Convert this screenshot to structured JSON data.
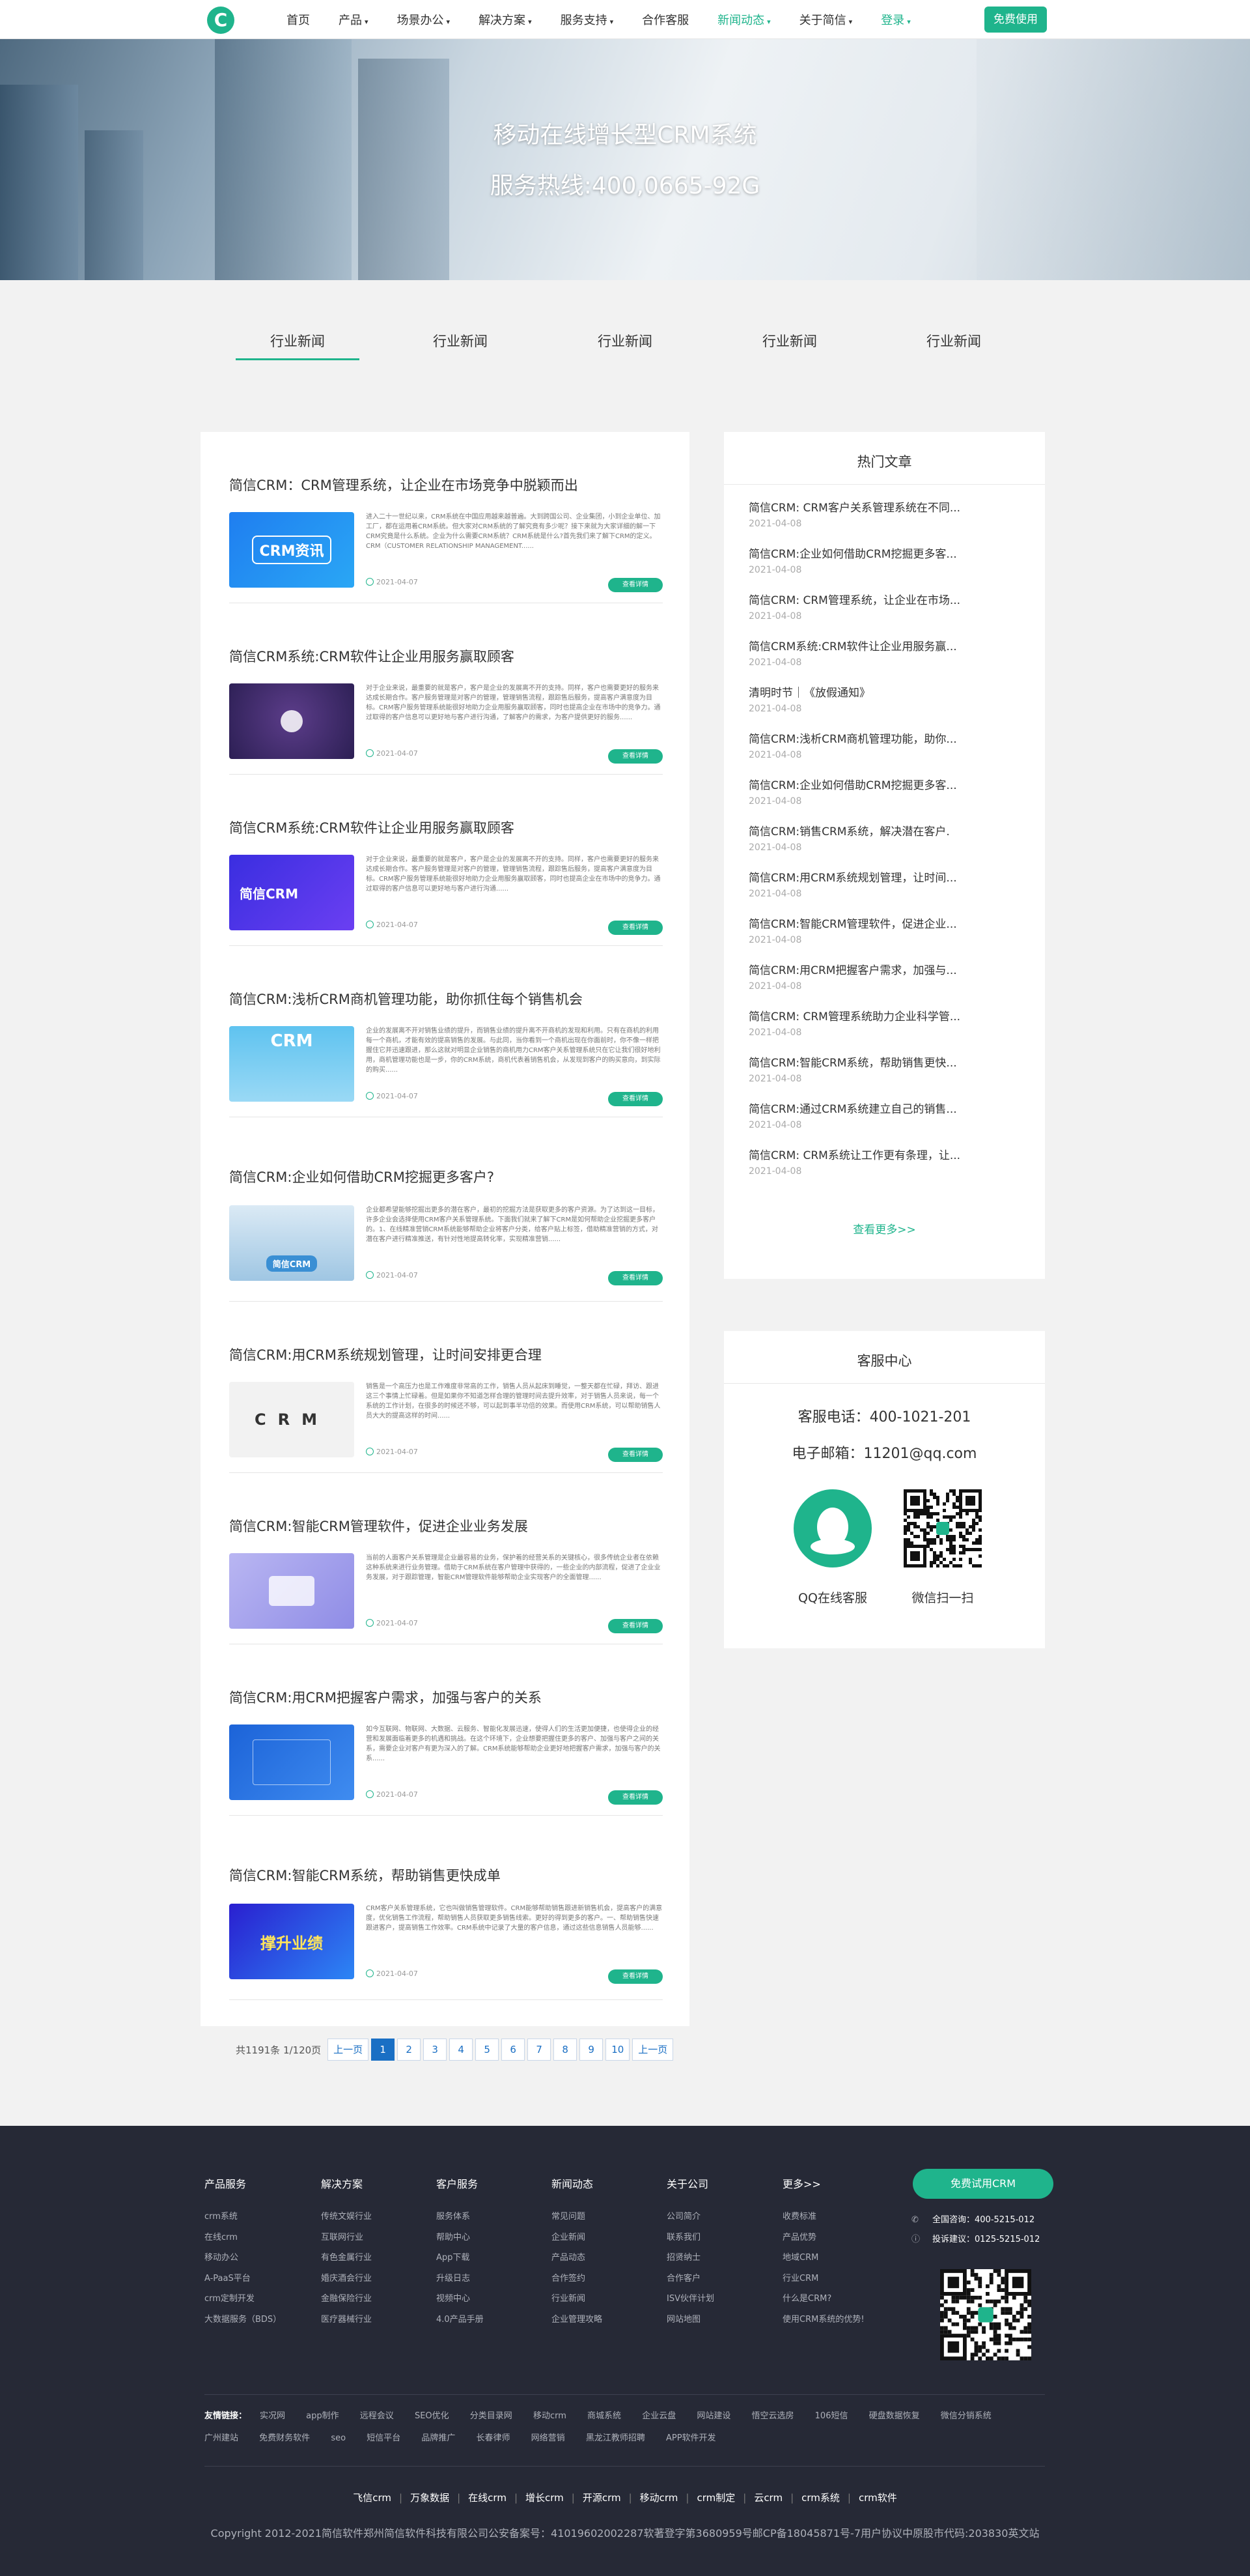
{
  "header": {
    "logo": "C",
    "nav": [
      {
        "label": "首页",
        "caret": ""
      },
      {
        "label": "产品",
        "caret": "▾"
      },
      {
        "label": "场景办公",
        "caret": "▾"
      },
      {
        "label": "解决方案",
        "caret": "▾"
      },
      {
        "label": "服务支持",
        "caret": "▾"
      },
      {
        "label": "合作客服",
        "caret": ""
      },
      {
        "label": "新闻动态",
        "caret": "▾"
      },
      {
        "label": "关于简信",
        "caret": "▾"
      },
      {
        "label": "登录",
        "caret": "▾"
      }
    ],
    "cta": "免费使用"
  },
  "banner": {
    "title": "移动在线增长型CRM系统",
    "hotline": "服务热线:400,0665-92G"
  },
  "tabs": [
    "行业新闻",
    "行业新闻",
    "行业新闻",
    "行业新闻",
    "行业新闻"
  ],
  "articles": [
    {
      "title": "简信CRM：CRM管理系统，让企业在市场竞争中脱颖而出",
      "thumb_text": "CRM资讯",
      "desc": "进入二十一世纪以来，CRM系统在中国应用越来越普遍。大到跨国公司、企业集团，小到企业单位、加工厂，都在运用着CRM系统。但大家对CRM系统的了解究竟有多少呢？接下来就为大家详细的解一下CRM究竟是什么系统。企业为什么需要CRM系统？CRM系统是什么?首先我们来了解下CRM的定义。CRM（CUSTOMER RELATIONSHIP MANAGEMENT......",
      "date": "2021-04-07",
      "more": "查看详情"
    },
    {
      "title": "简信CRM系统:CRM软件让企业用服务赢取顾客",
      "thumb_text": "",
      "desc": "对于企业来说，最重要的就是客户，客户是企业的发展离不开的支持。同样，客户也需要更好的服务来达成长期合作。客户服务管理是对客户的管理，管理销售流程，跟踪售后服务，提高客户满意度为目标。CRM客户服务管理系统能很好地助力企业用服务赢取顾客，同时也提高企业在市场中的竞争力。通过取得的客户信息可以更好地与客户进行沟通，了解客户的需求，为客户提供更好的服务......",
      "date": "2021-04-07",
      "more": "查看详情"
    },
    {
      "title": "简信CRM系统:CRM软件让企业用服务赢取顾客",
      "thumb_text": "简信CRM",
      "desc": "对于企业来说，最重要的就是客户，客户是企业的发展离不开的支持。同样，客户也需要更好的服务来达成长期合作。客户服务管理是对客户的管理，管理销售流程，跟踪售后服务，提高客户满意度为目标。CRM客户服务管理系统能很好地助力企业用服务赢取顾客，同时也提高企业在市场中的竞争力。通过取得的客户信息可以更好地与客户进行沟通......",
      "date": "2021-04-07",
      "more": "查看详情"
    },
    {
      "title": "简信CRM:浅析CRM商机管理功能，助你抓住每个销售机会",
      "thumb_text": "CRM",
      "desc": "企业的发展离不开对销售业绩的提升，而销售业绩的提升离不开商机的发现和利用。只有在商机的利用每一个商机，才能有效的提高销售的发展。与此同，当你看到一个商机出现在你面前时，你不像一样把握住它并迅速跟进，那么这就对明显企业销售的商机用力CRM客户关系管理系统只在它让我们很好地利用，商机管理功能也是一步，你的CRM系统，商机代表着销售机会，从发现到客户的购买意向，到实际的购买......",
      "date": "2021-04-07",
      "more": "查看详情"
    },
    {
      "title": "简信CRM:企业如何借助CRM挖掘更多客户?",
      "thumb_text": "简信CRM",
      "desc": "企业都希望能够挖掘出更多的潜在客户，最初的挖掘方法是获取更多的客户资源。为了达到这一目标，许多企业会选择使用CRM客户关系管理系统。下面我们就来了解下CRM是如何帮助企业挖掘更多客户的。1、在线精准营销CRM系统能够帮助企业将客户分类，给客户贴上标签，借助精准营销的方式，对潜在客户进行精准推送，有针对性地提高转化率，实现精准营销......",
      "date": "2021-04-07",
      "more": "查看详情"
    },
    {
      "title": "简信CRM:用CRM系统规划管理，让时间安排更合理",
      "thumb_text": "CRM",
      "desc": "销售是一个高压力也是工作难度非常高的工作，销售人员从起床到睡觉，一整天都在忙碌，拜访、跟进这三个事情上忙碌着。但是如果你不知道怎样合理的管理时间去提升效率，对于销售人员来说，每一个系统的工作计划，在很多的时候还不够，可以起到事半功倍的效果。而使用CRM系统，可以帮助销售人员大大的提高这样的时间......",
      "date": "2021-04-07",
      "more": "查看详情"
    },
    {
      "title": "简信CRM:智能CRM管理软件，促进企业业务发展",
      "thumb_text": "",
      "desc": "当前的人面客户关系管理是企业最容易的业务，保护着的经营关系的关键核心，很多传统企业者在依赖这种系统来进行业务管理。借助于CRM系统在客户管理中获得的，一些企业的内部流程，促进了企业业务发展，对于跟踪管理，智能CRM管理软件能够帮助企业实现客户的全面管理......",
      "date": "2021-04-07",
      "more": "查看详情"
    },
    {
      "title": "简信CRM:用CRM把握客户需求，加强与客户的关系",
      "thumb_text": "",
      "desc": "如今互联网、物联网、大数据、云服务、智能化发展迅速，使得人们的生活更加便捷，也使得企业的经营和发展面临着更多的机遇和挑战。在这个环境下，企业想要把握住更多的客户、加强与客户之间的关系，需要企业对客户有更为深入的了解。CRM系统能够帮助企业更好地把握客户需求，加强与客户的关系......",
      "date": "2021-04-07",
      "more": "查看详情"
    },
    {
      "title": "简信CRM:智能CRM系统，帮助销售更快成单",
      "thumb_text": "撑升业绩",
      "desc": "CRM客户关系管理系统，它也叫做销售管理软件。CRM能够帮助销售跟进新销售机会，提高客户的满意度，优化销售工作流程，帮助销售人员获取更多销售线索。更好的得到更多的客户。一、帮助销售快速跟进客户，提高销售工作效率。CRM系统中记录了大量的客户信息，通过这些信息销售人员能够......",
      "date": "2021-04-07",
      "more": "查看详情"
    }
  ],
  "pager": {
    "total": "共1191条 1/120页",
    "prev": "上一页",
    "pages": [
      "1",
      "2",
      "3",
      "4",
      "5",
      "6",
      "7",
      "8",
      "9",
      "10"
    ],
    "next": "上一页"
  },
  "hot": {
    "title": "热门文章",
    "items": [
      {
        "t": "简信CRM: CRM客户关系管理系统在不同...",
        "d": "2021-04-08"
      },
      {
        "t": "简信CRM:企业如何借助CRM挖掘更多客...",
        "d": "2021-04-08"
      },
      {
        "t": "简信CRM: CRM管理系统，让企业在市场...",
        "d": "2021-04-08"
      },
      {
        "t": "简信CRM系统:CRM软件让企业用服务赢...",
        "d": "2021-04-08"
      },
      {
        "t": "清明时节｜《放假通知》",
        "d": "2021-04-08"
      },
      {
        "t": "简信CRM:浅析CRM商机管理功能，助你...",
        "d": "2021-04-08"
      },
      {
        "t": "简信CRM:企业如何借助CRM挖掘更多客...",
        "d": "2021-04-08"
      },
      {
        "t": "简信CRM:销售CRM系统，解决潜在客户.",
        "d": "2021-04-08"
      },
      {
        "t": "简信CRM:用CRM系统规划管理，让时间...",
        "d": "2021-04-08"
      },
      {
        "t": "简信CRM:智能CRM管理软件，促进企业...",
        "d": "2021-04-08"
      },
      {
        "t": "简信CRM:用CRM把握客户需求，加强与...",
        "d": "2021-04-08"
      },
      {
        "t": "简信CRM: CRM管理系统助力企业科学管...",
        "d": "2021-04-08"
      },
      {
        "t": "简信CRM:智能CRM系统，帮助销售更快...",
        "d": "2021-04-08"
      },
      {
        "t": "简信CRM:通过CRM系统建立自己的销售...",
        "d": "2021-04-08"
      },
      {
        "t": "简信CRM: CRM系统让工作更有条理，让...",
        "d": "2021-04-08"
      }
    ],
    "more": "查看更多>>"
  },
  "service": {
    "title": "客服中心",
    "phone": "客服电话：400-1021-201",
    "email": "电子邮箱：11201@qq.com",
    "qq_caption": "QQ在线客服",
    "wechat_caption": "微信扫一扫"
  },
  "footer": {
    "columns": [
      {
        "head": "产品服务",
        "links": [
          "crm系统",
          "在线crm",
          "移动办公",
          "A-PaaS平台",
          "crm定制开发",
          "大数据服务（BDS）"
        ]
      },
      {
        "head": "解决方案",
        "links": [
          "传统文娱行业",
          "互联网行业",
          "有色金属行业",
          "婚庆酒会行业",
          "金融保险行业",
          "医疗器械行业"
        ]
      },
      {
        "head": "客户服务",
        "links": [
          "服务体系",
          "帮助中心",
          "App下载",
          "升级日志",
          "视频中心",
          "4.0产品手册"
        ]
      },
      {
        "head": "新闻动态",
        "links": [
          "常见问题",
          "企业新闻",
          "产品动态",
          "合作签约",
          "行业新闻",
          "企业管理攻略"
        ]
      },
      {
        "head": "关于公司",
        "links": [
          "公司简介",
          "联系我们",
          "招贤纳士",
          "合作客户",
          "ISV伙伴计划",
          "网站地图"
        ]
      },
      {
        "head": "更多>>",
        "links": [
          "收费标准",
          "产品优势",
          "地域CRM",
          "行业CRM",
          "什么是CRM?",
          "使用CRM系统的优势!"
        ]
      }
    ],
    "cta": "免费试用CRM",
    "hotline": "全国咨询：400-5215-012",
    "complaint": "投诉建议：0125-5215-012",
    "links_label": "友情链接：",
    "links": [
      "实况网",
      "app制作",
      "远程会议",
      "SEO优化",
      "分类目录网",
      "移动crm",
      "商城系统",
      "企业云盘",
      "网站建设",
      "悟空云选房",
      "106短信",
      "硬盘数据恢复",
      "微信分销系统",
      "广州建站",
      "免费财务软件",
      "seo",
      "短信平台",
      "品牌推广",
      "长春律师",
      "网络营销",
      "黑龙江教师招聘",
      "APP软件开发"
    ],
    "bar": [
      "飞信crm",
      "万象数据",
      "在线crm",
      "增长crm",
      "开源crm",
      "移动crm",
      "crm制定",
      "云crm",
      "crm系统",
      "crm软件"
    ],
    "copyright": "Copyright 2012-2021简信软件郑州简信软件科技有限公司公安备案号：41019602002287软著登字第3680959号邮CP备18045871号-7用户协议中原股市代码:203830英文站"
  },
  "colors": {
    "accent": "#1fb48c",
    "pager_blue": "#1a6fc4",
    "footer_bg": "#262936"
  }
}
